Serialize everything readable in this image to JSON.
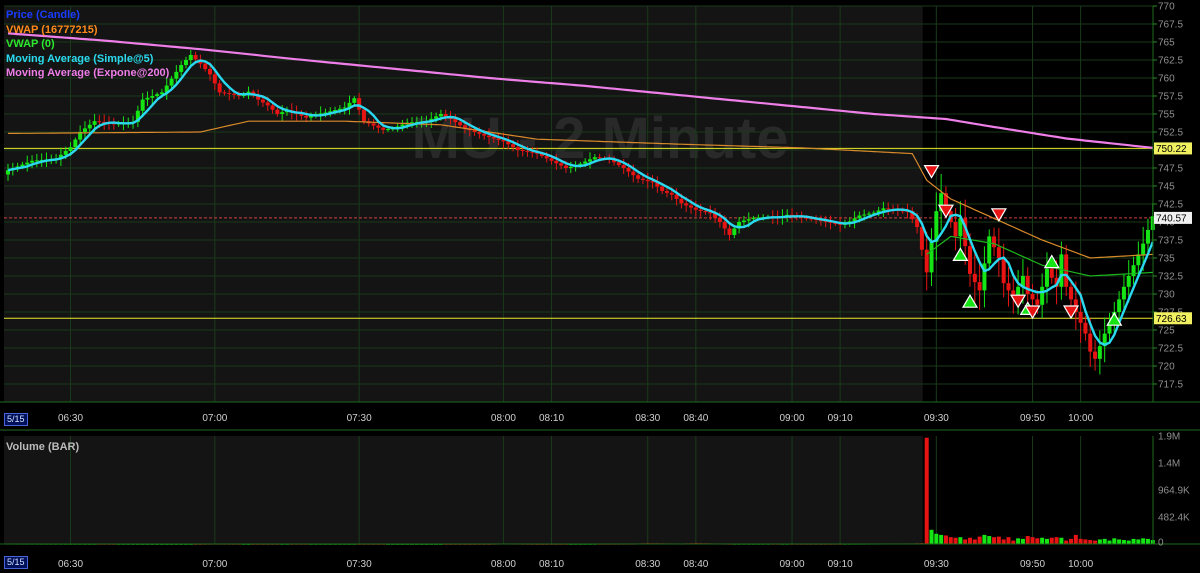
{
  "watermark": "MU - 2 Minute",
  "legend": [
    {
      "label": "Price (Candle)",
      "color": "#1a3cff"
    },
    {
      "label": "VWAP (16777215)",
      "color": "#ff8a1a"
    },
    {
      "label": "VWAP (0)",
      "color": "#2ee82e"
    },
    {
      "label": "Moving Average (Simple@5)",
      "color": "#2ad9f0"
    },
    {
      "label": "Moving Average (Expone@200)",
      "color": "#ee7ee8"
    }
  ],
  "volume_title": "Volume (BAR)",
  "date_label": "5/15",
  "colors": {
    "up": "#15e515",
    "down": "#e81414",
    "sma": "#2ad9f0",
    "ema": "#ee7ee8",
    "vwap": "#d98a2a",
    "vwap0": "#1cb81c",
    "level": "#e8e82a",
    "grid": "#1a3a1a"
  },
  "chart_data": {
    "type": "candlestick",
    "title": "MU - 2 Minute",
    "ylim": [
      715,
      770
    ],
    "y_ticks": [
      "717.5",
      "720",
      "722.5",
      "725",
      "727.5",
      "730",
      "732.5",
      "735",
      "737.5",
      "740",
      "742.5",
      "745",
      "747.5",
      "750",
      "752.5",
      "755",
      "757.5",
      "760",
      "762.5",
      "765",
      "767.5",
      "770"
    ],
    "x_ticks": [
      "06:30",
      "07:00",
      "07:30",
      "08:00",
      "08:10",
      "08:30",
      "08:40",
      "09:00",
      "09:10",
      "09:30",
      "09:50",
      "10:00"
    ],
    "x_tick_bars": [
      13,
      43,
      73,
      103,
      113,
      133,
      143,
      163,
      173,
      193,
      213,
      223
    ],
    "session_start_bar": 191,
    "horizontal_levels": [
      {
        "label": "750.22",
        "value": 750.22
      },
      {
        "label": "726.63",
        "value": 726.63
      }
    ],
    "last_price": {
      "label": "740.57",
      "value": 740.57
    },
    "volume_axis": {
      "ticks": [
        "0",
        "482.4K",
        "964.9K",
        "1.4M",
        "1.9M"
      ],
      "max": 1900000
    },
    "anchors": {
      "close": [
        [
          0,
          747.2
        ],
        [
          5,
          748.5
        ],
        [
          10,
          748.8
        ],
        [
          13,
          750.4
        ],
        [
          15,
          752.5
        ],
        [
          18,
          754.0
        ],
        [
          22,
          753.6
        ],
        [
          26,
          753.9
        ],
        [
          28,
          757.0
        ],
        [
          32,
          758.0
        ],
        [
          36,
          761.8
        ],
        [
          38,
          763.2
        ],
        [
          40,
          762.0
        ],
        [
          42,
          760.5
        ],
        [
          44,
          758.0
        ],
        [
          46,
          757.8
        ],
        [
          48,
          757.5
        ],
        [
          50,
          758.1
        ],
        [
          52,
          757.0
        ],
        [
          54,
          756.2
        ],
        [
          56,
          755.0
        ],
        [
          58,
          755.5
        ],
        [
          60,
          755.0
        ],
        [
          62,
          754.5
        ],
        [
          64,
          755.0
        ],
        [
          66,
          755.2
        ],
        [
          70,
          755.9
        ],
        [
          72,
          757.2
        ],
        [
          74,
          754.0
        ],
        [
          78,
          752.8
        ],
        [
          80,
          753.0
        ],
        [
          83,
          753.8
        ],
        [
          87,
          754.0
        ],
        [
          90,
          755.0
        ],
        [
          92,
          754.3
        ],
        [
          95,
          753.0
        ],
        [
          99,
          752.0
        ],
        [
          103,
          751.2
        ],
        [
          106,
          750.0
        ],
        [
          110,
          749.5
        ],
        [
          113,
          748.5
        ],
        [
          116,
          747.5
        ],
        [
          118,
          747.8
        ],
        [
          122,
          749.0
        ],
        [
          125,
          748.7
        ],
        [
          128,
          747.5
        ],
        [
          131,
          746.0
        ],
        [
          134,
          745.5
        ],
        [
          136,
          744.3
        ],
        [
          138,
          743.8
        ],
        [
          140,
          742.6
        ],
        [
          143,
          741.7
        ],
        [
          146,
          741.2
        ],
        [
          148,
          740.0
        ],
        [
          150,
          738.2
        ],
        [
          152,
          740.0
        ],
        [
          155,
          740.6
        ],
        [
          158,
          740.7
        ],
        [
          160,
          740.6
        ],
        [
          162,
          741.0
        ],
        [
          164,
          740.7
        ],
        [
          167,
          740.4
        ],
        [
          170,
          740.0
        ],
        [
          173,
          739.6
        ],
        [
          175,
          740.1
        ],
        [
          177,
          740.9
        ],
        [
          180,
          741.3
        ],
        [
          182,
          741.9
        ],
        [
          185,
          741.6
        ],
        [
          187,
          741.5
        ],
        [
          189,
          739.3
        ],
        [
          191,
          733.0
        ],
        [
          193,
          741.5
        ],
        [
          194,
          744.0
        ],
        [
          195,
          741.5
        ],
        [
          196,
          740.0
        ],
        [
          197,
          738.0
        ],
        [
          198,
          740.5
        ],
        [
          200,
          732.8
        ],
        [
          202,
          730.5
        ],
        [
          204,
          738.0
        ],
        [
          206,
          735.0
        ],
        [
          207,
          731.5
        ],
        [
          209,
          729.5
        ],
        [
          211,
          732.5
        ],
        [
          212,
          730.0
        ],
        [
          214,
          728.5
        ],
        [
          216,
          733.5
        ],
        [
          218,
          731.0
        ],
        [
          219,
          735.5
        ],
        [
          220,
          731.0
        ],
        [
          222,
          727.5
        ],
        [
          224,
          724.5
        ],
        [
          225,
          722.0
        ],
        [
          226,
          721.0
        ],
        [
          228,
          724.5
        ],
        [
          230,
          727.5
        ],
        [
          232,
          731.0
        ],
        [
          234,
          734.0
        ],
        [
          236,
          737.0
        ],
        [
          238,
          740.8
        ]
      ],
      "volume": [
        [
          0,
          8000
        ],
        [
          10,
          6000
        ],
        [
          20,
          5000
        ],
        [
          30,
          4000
        ],
        [
          40,
          4000
        ],
        [
          43,
          7000
        ],
        [
          50,
          4000
        ],
        [
          60,
          5000
        ],
        [
          70,
          5000
        ],
        [
          80,
          4000
        ],
        [
          90,
          4000
        ],
        [
          100,
          4000
        ],
        [
          103,
          9000
        ],
        [
          110,
          4000
        ],
        [
          120,
          5000
        ],
        [
          130,
          7000
        ],
        [
          133,
          14000
        ],
        [
          140,
          8000
        ],
        [
          143,
          15000
        ],
        [
          150,
          6000
        ],
        [
          160,
          6000
        ],
        [
          170,
          5000
        ],
        [
          180,
          8000
        ],
        [
          188,
          10000
        ],
        [
          190,
          14000
        ],
        [
          191,
          1870000
        ],
        [
          192,
          250000
        ],
        [
          193,
          180000
        ],
        [
          194,
          160000
        ],
        [
          195,
          150000
        ],
        [
          196,
          120000
        ],
        [
          197,
          110000
        ],
        [
          198,
          120000
        ],
        [
          199,
          80000
        ],
        [
          200,
          110000
        ],
        [
          201,
          80000
        ],
        [
          202,
          130000
        ],
        [
          203,
          160000
        ],
        [
          204,
          140000
        ],
        [
          205,
          120000
        ],
        [
          206,
          130000
        ],
        [
          207,
          80000
        ],
        [
          208,
          120000
        ],
        [
          209,
          60000
        ],
        [
          210,
          100000
        ],
        [
          211,
          90000
        ],
        [
          212,
          140000
        ],
        [
          213,
          120000
        ],
        [
          214,
          100000
        ],
        [
          215,
          110000
        ],
        [
          216,
          90000
        ],
        [
          217,
          110000
        ],
        [
          218,
          120000
        ],
        [
          219,
          110000
        ],
        [
          220,
          60000
        ],
        [
          221,
          90000
        ],
        [
          222,
          160000
        ],
        [
          223,
          90000
        ],
        [
          224,
          80000
        ],
        [
          225,
          70000
        ],
        [
          226,
          60000
        ],
        [
          227,
          80000
        ],
        [
          228,
          90000
        ],
        [
          229,
          60000
        ],
        [
          230,
          100000
        ],
        [
          231,
          80000
        ],
        [
          232,
          70000
        ],
        [
          233,
          60000
        ],
        [
          234,
          90000
        ],
        [
          235,
          80000
        ],
        [
          236,
          100000
        ],
        [
          237,
          90000
        ],
        [
          238,
          70000
        ]
      ]
    },
    "vwap": [
      [
        0,
        752.3
      ],
      [
        40,
        752.5
      ],
      [
        50,
        754.0
      ],
      [
        70,
        754.0
      ],
      [
        90,
        753.5
      ],
      [
        110,
        751.5
      ],
      [
        140,
        750.8
      ],
      [
        165,
        750.3
      ],
      [
        188,
        749.5
      ],
      [
        191,
        745.8
      ],
      [
        196,
        743.2
      ],
      [
        205,
        740.5
      ],
      [
        215,
        737.5
      ],
      [
        225,
        735.0
      ],
      [
        238,
        735.5
      ]
    ],
    "vwap0": [
      [
        191,
        735.5
      ],
      [
        196,
        738.0
      ],
      [
        205,
        737.0
      ],
      [
        215,
        734.0
      ],
      [
        225,
        732.5
      ],
      [
        238,
        733.0
      ]
    ],
    "ema200": [
      [
        0,
        766.2
      ],
      [
        20,
        765.2
      ],
      [
        40,
        764.0
      ],
      [
        60,
        762.6
      ],
      [
        80,
        761.3
      ],
      [
        100,
        760.0
      ],
      [
        120,
        758.9
      ],
      [
        140,
        757.6
      ],
      [
        160,
        756.3
      ],
      [
        180,
        755.0
      ],
      [
        195,
        754.3
      ],
      [
        205,
        753.2
      ],
      [
        220,
        751.6
      ],
      [
        238,
        750.3
      ]
    ],
    "signals": [
      {
        "bar": 192,
        "dir": "down",
        "value": 747.0
      },
      {
        "bar": 195,
        "dir": "down",
        "value": 741.5
      },
      {
        "bar": 198,
        "dir": "up",
        "value": 735.5
      },
      {
        "bar": 200,
        "dir": "up",
        "value": 729.0
      },
      {
        "bar": 206,
        "dir": "down",
        "value": 741.0
      },
      {
        "bar": 210,
        "dir": "down",
        "value": 729.0
      },
      {
        "bar": 212,
        "dir": "up",
        "value": 728.0
      },
      {
        "bar": 213,
        "dir": "down",
        "value": 727.5
      },
      {
        "bar": 217,
        "dir": "up",
        "value": 734.5
      },
      {
        "bar": 221,
        "dir": "down",
        "value": 727.5
      },
      {
        "bar": 230,
        "dir": "up",
        "value": 726.5
      }
    ]
  }
}
